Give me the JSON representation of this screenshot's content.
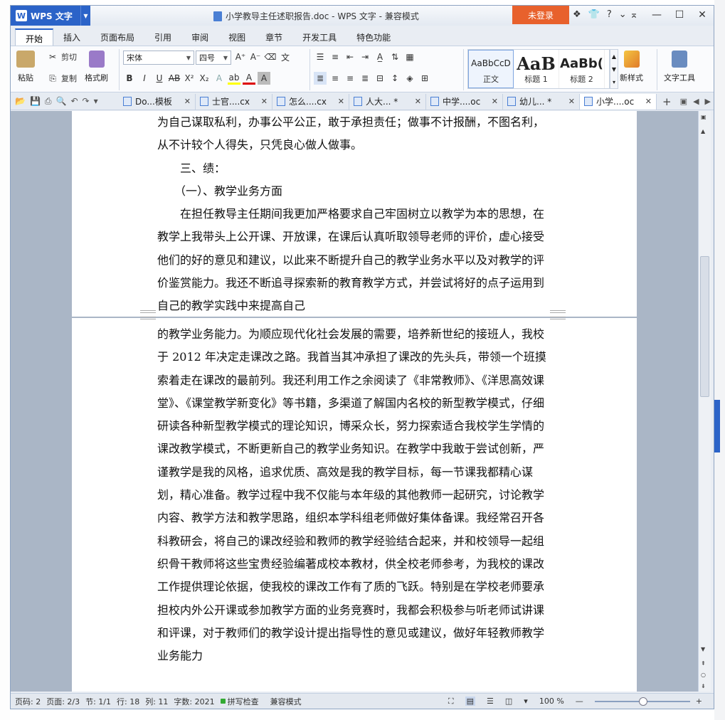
{
  "app": {
    "name": "WPS 文字",
    "doc_title": "小学教导主任述职报告.doc - WPS 文字 - 兼容模式",
    "login": "未登录"
  },
  "title_icons": [
    "❖",
    "👕",
    "?",
    "⌄"
  ],
  "ribbon_tabs": [
    "开始",
    "插入",
    "页面布局",
    "引用",
    "审阅",
    "视图",
    "章节",
    "开发工具",
    "特色功能"
  ],
  "ribbon": {
    "paste": "粘贴",
    "cut": "剪切",
    "copy": "复制",
    "format_painter": "格式刷",
    "font_name": "宋体",
    "font_size": "四号",
    "styles": [
      {
        "sample": "AaBbCcD",
        "name": "正文"
      },
      {
        "sample": "AaB",
        "name": "标题 1"
      },
      {
        "sample": "AaBb(",
        "name": "标题 2"
      }
    ],
    "new_style": "新样式",
    "text_tools": "文字工具"
  },
  "doc_tabs": [
    {
      "label": "Do...模板"
    },
    {
      "label": "士官....cx"
    },
    {
      "label": "怎么....cx"
    },
    {
      "label": "人大... *"
    },
    {
      "label": "中学....oc"
    },
    {
      "label": "幼儿... *"
    },
    {
      "label": "小学....oc"
    }
  ],
  "page1_text": "为自己谋取私利，办事公平公正，敢于承担责任；做事不计报酬，不图名利，从不计较个人得失，只凭良心做人做事。\n　　三、绩：\n　　（一）、教学业务方面\n　　在担任教导主任期间我更加严格要求自己牢固树立以教学为本的思想，在教学上我带头上公开课、开放课，在课后认真听取领导老师的评价，虚心接受他们的好的意见和建议，以此来不断提升自己的教学业务水平以及对教学的评价鉴赏能力。我还不断追寻探索新的教育教学方式，并尝试将好的点子运用到自己的教学实践中来提高自己",
  "page2_text": "的教学业务能力。为顺应现代化社会发展的需要，培养新世纪的接班人，我校于 2012 年决定走课改之路。我首当其冲承担了课改的先头兵，带领一个班摸索着走在课改的最前列。我还利用工作之余阅读了《非常教师》、《洋思高效课堂》、《课堂教学新变化》等书籍，多渠道了解国内名校的新型教学模式，仔细研读各种新型教学模式的理论知识，博采众长，努力探索适合我校学生学情的课改教学模式，不断更新自己的教学业务知识。在教学中我敢于尝试创新，严谨教学是我的风格，追求优质、高效是我的教学目标，每一节课我都精心谋划，精心准备。教学过程中我不仅能与本年级的其他教师一起研究，讨论教学内容、教学方法和教学思路，组织本学科组老师做好集体备课。我经常召开各科教研会，将自己的课改经验和教师的教学经验结合起来，并和校领导一起组织骨干教师将这些宝贵经验编著成校本教材，供全校老师参考，为我校的课改工作提供理论依据，使我校的课改工作有了质的飞跃。特别是在学校老师要承担校内外公开课或参加教学方面的业务竞赛时，我都会积极参与听老师试讲课和评课，对于教师们的教学设计提出指导性的意见或建议，做好年轻教师教学业务能力",
  "status": {
    "page_no": "页码: 2",
    "pages": "页面: 2/3",
    "section": "节: 1/1",
    "row": "行: 18",
    "col": "列: 11",
    "words": "字数: 2021",
    "spell": "拼写检查",
    "mode": "兼容模式",
    "zoom": "100 %"
  }
}
